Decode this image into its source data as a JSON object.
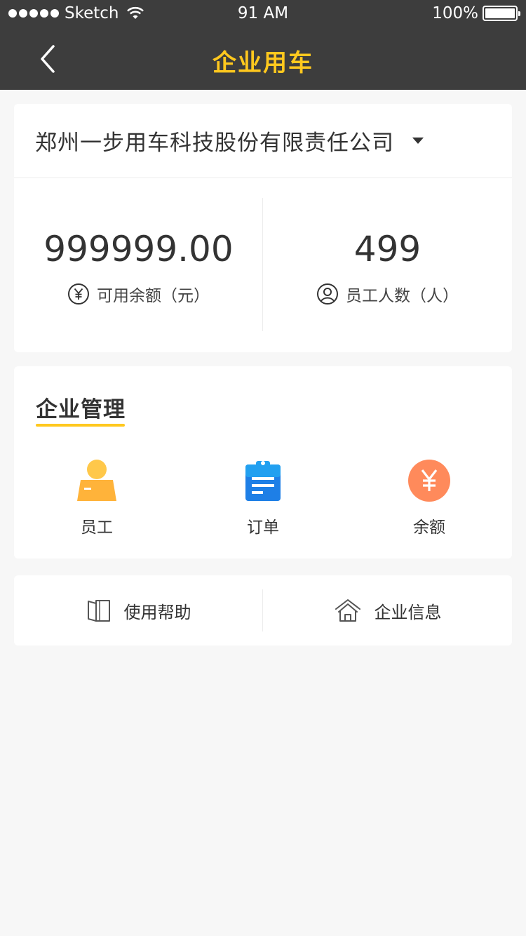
{
  "status_bar": {
    "carrier": "Sketch",
    "time": "91 AM",
    "battery": "100%"
  },
  "header": {
    "title": "企业用车",
    "title_color": "#ffc81e",
    "background": "#3d3d3d"
  },
  "company": {
    "name": "郑州一步用车科技股份有限责任公司"
  },
  "stats": {
    "balance_value": "999999.00",
    "balance_label": "可用余额（元）",
    "employees_value": "499",
    "employees_label": "员工人数（人）"
  },
  "management": {
    "title": "企业管理",
    "items": [
      {
        "label": "员工",
        "icon": "employee-icon",
        "color": "#ffb33a"
      },
      {
        "label": "订单",
        "icon": "order-clipboard-icon",
        "color": "#1e7fe6"
      },
      {
        "label": "余额",
        "icon": "yuan-coin-icon",
        "color": "#ff8a5b"
      }
    ]
  },
  "links": {
    "help_label": "使用帮助",
    "help_icon": "book-icon",
    "info_label": "企业信息",
    "info_icon": "house-icon"
  }
}
